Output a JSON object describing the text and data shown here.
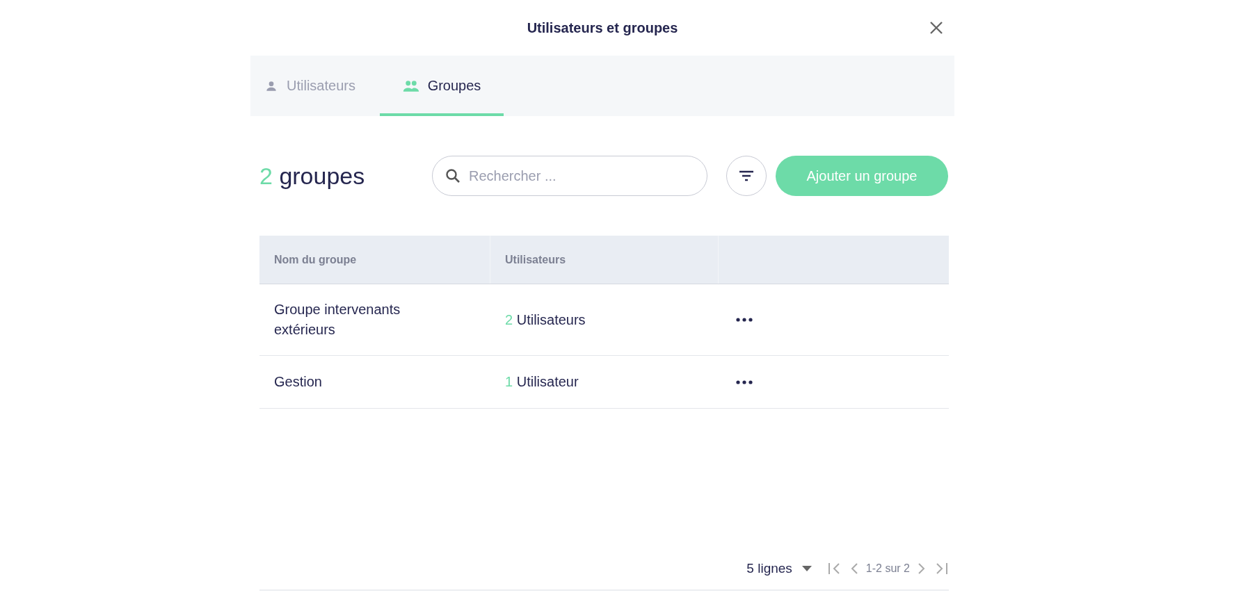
{
  "dialog": {
    "title": "Utilisateurs et groupes"
  },
  "tabs": [
    {
      "label": "Utilisateurs",
      "selected": false
    },
    {
      "label": "Groupes",
      "selected": true
    }
  ],
  "heading": {
    "count": "2",
    "label": "groupes"
  },
  "search": {
    "placeholder": "Rechercher ..."
  },
  "add_button": "Ajouter un groupe",
  "table": {
    "columns": [
      "Nom du groupe",
      "Utilisateurs"
    ],
    "rows": [
      {
        "name": "Groupe intervenants extérieurs",
        "count": "2",
        "unit": "Utilisateurs"
      },
      {
        "name": "Gestion",
        "count": "1",
        "unit": "Utilisateur"
      }
    ]
  },
  "pagination": {
    "rows_per_page": "5 lignes",
    "range": "1-2 sur 2"
  }
}
